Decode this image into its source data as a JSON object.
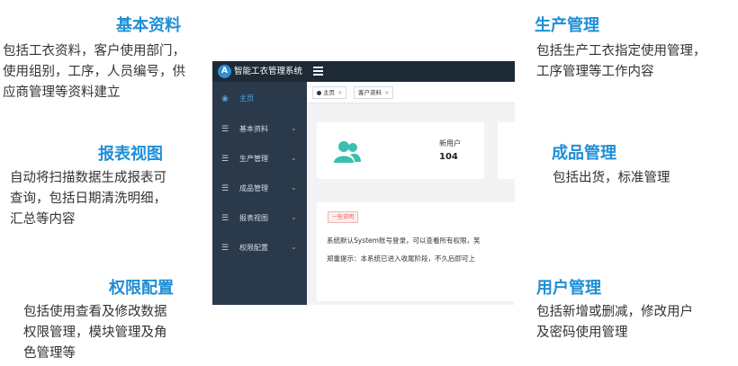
{
  "features": {
    "basic": {
      "title": "基本资料",
      "lines": [
        "包括工衣资料，客户使用部门，",
        "使用组别，工序，人员编号，供",
        "应商管理等资料建立"
      ]
    },
    "report": {
      "title": "报表视图",
      "lines": [
        "自动将扫描数据生成报表可",
        "查询，包括日期清洗明细，",
        "汇总等内容"
      ]
    },
    "permission": {
      "title": "权限配置",
      "lines": [
        "包括使用查看及修改数据",
        "权限管理，模块管理及角",
        "色管理等"
      ]
    },
    "production": {
      "title": "生产管理",
      "lines": [
        "包括生产工衣指定使用管理，",
        "工序管理等工作内容"
      ]
    },
    "product": {
      "title": "成品管理",
      "lines": [
        "包括出货，标准管理"
      ]
    },
    "user": {
      "title": "用户管理",
      "lines": [
        "包括新增或删减，修改用户",
        "及密码使用管理"
      ]
    }
  },
  "app": {
    "logo_glyph": "A",
    "title": "智能工衣管理系统",
    "sidebar": [
      {
        "label": "主页",
        "icon": "◉",
        "active": true,
        "caret": ""
      },
      {
        "label": "基本资料",
        "icon": "☰",
        "active": false,
        "caret": "⌄"
      },
      {
        "label": "生产管理",
        "icon": "☰",
        "active": false,
        "caret": "⌄"
      },
      {
        "label": "成品管理",
        "icon": "☰",
        "active": false,
        "caret": "⌄"
      },
      {
        "label": "报表视图",
        "icon": "☰",
        "active": false,
        "caret": "⌄"
      },
      {
        "label": "权限配置",
        "icon": "☰",
        "active": false,
        "caret": "⌄"
      }
    ],
    "tabs": [
      {
        "label": "主页",
        "close": "×"
      },
      {
        "label": "客户资料",
        "close": "×"
      }
    ],
    "stat": {
      "label": "新用户",
      "value": "104"
    },
    "notice": {
      "badge": "一些说明",
      "line1": "系统默认System账号登录，可以查看所有权限，笑",
      "line2": "郑重提示：本系统已进入收尾阶段，不久后即可上"
    }
  },
  "colors": {
    "title": "#1f8ed6",
    "sidebar": "#2b3a4a",
    "topbar": "#1e2a36",
    "accent_icon": "#3bbfae"
  }
}
